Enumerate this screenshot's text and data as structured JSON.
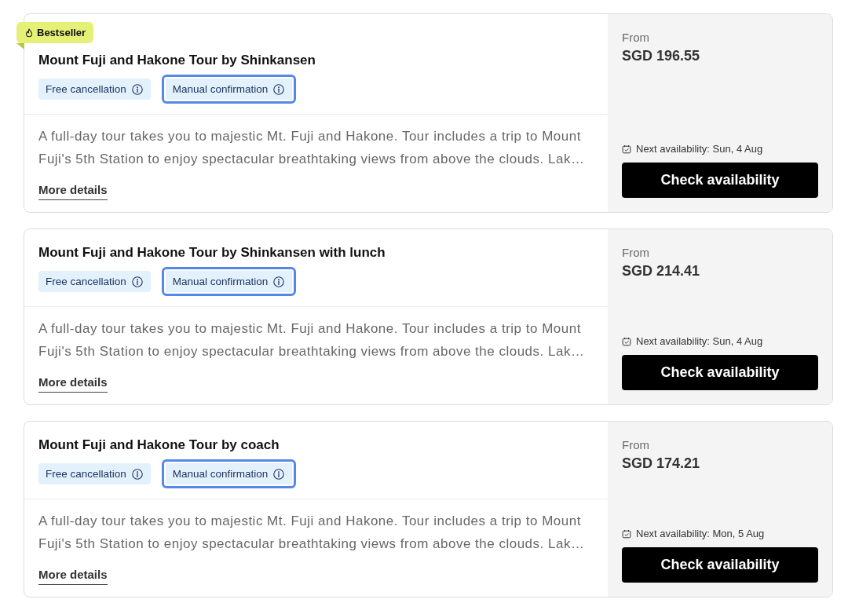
{
  "tours": [
    {
      "badge": {
        "label": "Bestseller"
      },
      "title": "Mount Fuji and Hakone Tour by Shinkansen",
      "tags": [
        {
          "label": "Free cancellation",
          "highlighted": false
        },
        {
          "label": "Manual confirmation",
          "highlighted": true
        }
      ],
      "description": "A full-day tour takes you to majestic Mt. Fuji and Hakone. Tour includes a trip to Mount Fuji's 5th Station to enjoy spectacular breathtaking views from above the clouds. Lak…",
      "link": "More details",
      "price_label": "From",
      "price": "SGD 196.55",
      "availability": "Next availability: Sun, 4 Aug",
      "button": "Check availability"
    },
    {
      "title": "Mount Fuji and Hakone Tour by Shinkansen with lunch",
      "tags": [
        {
          "label": "Free cancellation",
          "highlighted": false
        },
        {
          "label": "Manual confirmation",
          "highlighted": true
        }
      ],
      "description": "A full-day tour takes you to majestic Mt. Fuji and Hakone. Tour includes a trip to Mount Fuji's 5th Station to enjoy spectacular breathtaking views from above the clouds. Lak…",
      "link": "More details",
      "price_label": "From",
      "price": "SGD 214.41",
      "availability": "Next availability: Sun, 4 Aug",
      "button": "Check availability"
    },
    {
      "title": "Mount Fuji and Hakone Tour by coach",
      "tags": [
        {
          "label": "Free cancellation",
          "highlighted": false
        },
        {
          "label": "Manual confirmation",
          "highlighted": true
        }
      ],
      "description": "A full-day tour takes you to majestic Mt. Fuji and Hakone. Tour includes a trip to Mount Fuji's 5th Station to enjoy spectacular breathtaking views from above the clouds. Lak…",
      "link": "More details",
      "price_label": "From",
      "price": "SGD 174.21",
      "availability": "Next availability: Mon, 5 Aug",
      "button": "Check availability"
    }
  ]
}
